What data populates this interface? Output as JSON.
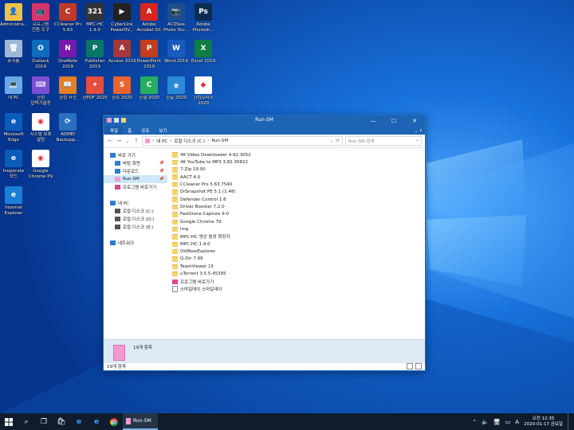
{
  "desktop": {
    "icons": [
      {
        "label": "Administra...",
        "col": 0,
        "row": 0,
        "color": "#f0c14b",
        "glyph": "👤"
      },
      {
        "label": "프로그램\n전환 도구",
        "col": 1,
        "row": 0,
        "color": "#d6336c",
        "glyph": "📺"
      },
      {
        "label": "CCleaner Pro\n5.63",
        "col": 2,
        "row": 0,
        "color": "#c0392b",
        "glyph": "C"
      },
      {
        "label": "MPC-HC\n1.9.0",
        "col": 3,
        "row": 0,
        "color": "#333333",
        "glyph": "321"
      },
      {
        "label": "CyberLink\nPowerDV...",
        "col": 4,
        "row": 0,
        "color": "#222222",
        "glyph": "▶"
      },
      {
        "label": "Adobe\nAcrobat DC",
        "col": 5,
        "row": 0,
        "color": "#d9261c",
        "glyph": "A"
      },
      {
        "label": "ACDSee\nPhoto Stu...",
        "col": 6,
        "row": 0,
        "color": "#1e4f8c",
        "glyph": "📷"
      },
      {
        "label": "Adobe\nPhotosh...",
        "col": 7,
        "row": 0,
        "color": "#0b2d52",
        "glyph": "Ps"
      },
      {
        "label": "휴지통",
        "col": 0,
        "row": 1,
        "color": "#9fb7d6",
        "glyph": "🗑"
      },
      {
        "label": "Outlook\n2019",
        "col": 1,
        "row": 1,
        "color": "#0f6cbd",
        "glyph": "O"
      },
      {
        "label": "OneNote\n2019",
        "col": 2,
        "row": 1,
        "color": "#7719aa",
        "glyph": "N"
      },
      {
        "label": "Publisher\n2019",
        "col": 3,
        "row": 1,
        "color": "#077568",
        "glyph": "P"
      },
      {
        "label": "Access 2019",
        "col": 4,
        "row": 1,
        "color": "#a4373a",
        "glyph": "A"
      },
      {
        "label": "PowerPoint\n2019",
        "col": 5,
        "row": 1,
        "color": "#c43e1c",
        "glyph": "P"
      },
      {
        "label": "Word 2019",
        "col": 6,
        "row": 1,
        "color": "#185abd",
        "glyph": "W"
      },
      {
        "label": "Excel 2019",
        "col": 7,
        "row": 1,
        "color": "#107c41",
        "glyph": "X"
      },
      {
        "label": "내 PC",
        "col": 0,
        "row": 2,
        "color": "#6aa9e8",
        "glyph": "💻"
      },
      {
        "label": "한컴\n입력기설정",
        "col": 1,
        "row": 2,
        "color": "#7a4fd1",
        "glyph": "⌨"
      },
      {
        "label": "한컴 사전",
        "col": 2,
        "row": 2,
        "color": "#e67e22",
        "glyph": "📖"
      },
      {
        "label": "한PDF 2020",
        "col": 3,
        "row": 2,
        "color": "#e74c3c",
        "glyph": "✦"
      },
      {
        "label": "한쇼 2020",
        "col": 4,
        "row": 2,
        "color": "#e8632e",
        "glyph": "S"
      },
      {
        "label": "한셀 2020",
        "col": 5,
        "row": 2,
        "color": "#27ae60",
        "glyph": "C"
      },
      {
        "label": "한글 2020",
        "col": 6,
        "row": 2,
        "color": "#2b8ad8",
        "glyph": "ㅎ"
      },
      {
        "label": "한컴오피스\n2020",
        "col": 7,
        "row": 2,
        "color": "#ffffff",
        "glyph": "◆"
      },
      {
        "label": "Microsoft\nEdge",
        "col": 0,
        "row": 3,
        "color": "#0a5cb8",
        "glyph": "e"
      },
      {
        "label": "시스템 보호\n설정",
        "col": 1,
        "row": 3,
        "color": "#ffffff",
        "glyph": "◉"
      },
      {
        "label": "AOMEI\nBackupp...",
        "col": 2,
        "row": 3,
        "color": "#2b6fbf",
        "glyph": "⟳"
      },
      {
        "label": "Inoperate\n모드",
        "col": 0,
        "row": 4,
        "color": "#0a5cb8",
        "glyph": "e"
      },
      {
        "label": "Google\nChrome P9",
        "col": 1,
        "row": 4,
        "color": "#ffffff",
        "glyph": "◉"
      },
      {
        "label": "Internet\nExplorer",
        "col": 0,
        "row": 5,
        "color": "#1c7fd6",
        "glyph": "e"
      }
    ]
  },
  "window": {
    "title": "Run-SM",
    "tabs": [
      "파일",
      "홈",
      "공유",
      "보기"
    ],
    "address": {
      "segments": [
        "내 PC",
        "로컬 디스크 (C:)",
        "Run-SM"
      ],
      "separator": "›"
    },
    "search_placeholder": "Run-SM 검색",
    "nav": [
      {
        "label": "바로 가기",
        "icon": "star-icon",
        "level": 0,
        "selected": false,
        "pinned": false
      },
      {
        "label": "바탕 화면",
        "icon": "desktop-icon",
        "level": 1,
        "selected": false,
        "pinned": true
      },
      {
        "label": "다운로드",
        "icon": "download-icon",
        "level": 1,
        "selected": false,
        "pinned": true
      },
      {
        "label": "Run-SM",
        "icon": "folder-pink-icon",
        "level": 1,
        "selected": true,
        "pinned": true
      },
      {
        "label": "프로그램 바로가기",
        "icon": "shortcut-icon",
        "level": 1,
        "selected": false,
        "pinned": false
      },
      {
        "label": "",
        "icon": "",
        "level": 0,
        "selected": false,
        "pinned": false
      },
      {
        "label": "내 PC",
        "icon": "pc-icon",
        "level": 0,
        "selected": false,
        "pinned": false
      },
      {
        "label": "로컬 디스크 (C:)",
        "icon": "drive-icon",
        "level": 1,
        "selected": false,
        "pinned": false
      },
      {
        "label": "로컬 디스크 (D:)",
        "icon": "drive-icon",
        "level": 1,
        "selected": false,
        "pinned": false
      },
      {
        "label": "로컬 디스크 (E:)",
        "icon": "drive-icon",
        "level": 1,
        "selected": false,
        "pinned": false
      },
      {
        "label": "",
        "icon": "",
        "level": 0,
        "selected": false,
        "pinned": false
      },
      {
        "label": "네트워크",
        "icon": "network-icon",
        "level": 0,
        "selected": false,
        "pinned": false
      }
    ],
    "files": [
      {
        "name": "4K Video Downloader 4.92.3052",
        "type": "folder"
      },
      {
        "name": "4K YouTube to MP3 3.82.30822",
        "type": "folder"
      },
      {
        "name": "7-Zip 19.00",
        "type": "folder"
      },
      {
        "name": "AACT 4.0",
        "type": "folder"
      },
      {
        "name": "CCleaner Pro 5.63.7540",
        "type": "folder"
      },
      {
        "name": "DrSnapshot PE 5.1 (1.48)",
        "type": "folder"
      },
      {
        "name": "Defender Control 1.6",
        "type": "folder"
      },
      {
        "name": "Driver Booster 7.2.0",
        "type": "folder"
      },
      {
        "name": "FastStone Capture 9.0",
        "type": "folder"
      },
      {
        "name": "Google Chrome 79",
        "type": "folder"
      },
      {
        "name": "img",
        "type": "folder"
      },
      {
        "name": "MPC-HC 영상 음성 확장자",
        "type": "folder"
      },
      {
        "name": "MPC-HC.1.9.0",
        "type": "folder"
      },
      {
        "name": "OldNewExplorer",
        "type": "folder"
      },
      {
        "name": "Q-Dir 7.99",
        "type": "folder"
      },
      {
        "name": "TeamViewer 15",
        "type": "folder"
      },
      {
        "name": "uTorrent 3.5.5.45395",
        "type": "folder"
      },
      {
        "name": "프로그램 바로가기",
        "type": "shortcut"
      },
      {
        "name": "스마일데이 스마일데이",
        "type": "file"
      }
    ],
    "details_count": "19개 항목",
    "status_count": "19개 항목"
  },
  "taskbar": {
    "running_label": "Run-SM",
    "ime": "A",
    "clock_time": "오전 12:35",
    "clock_date": "2020-01-17 금요일"
  }
}
